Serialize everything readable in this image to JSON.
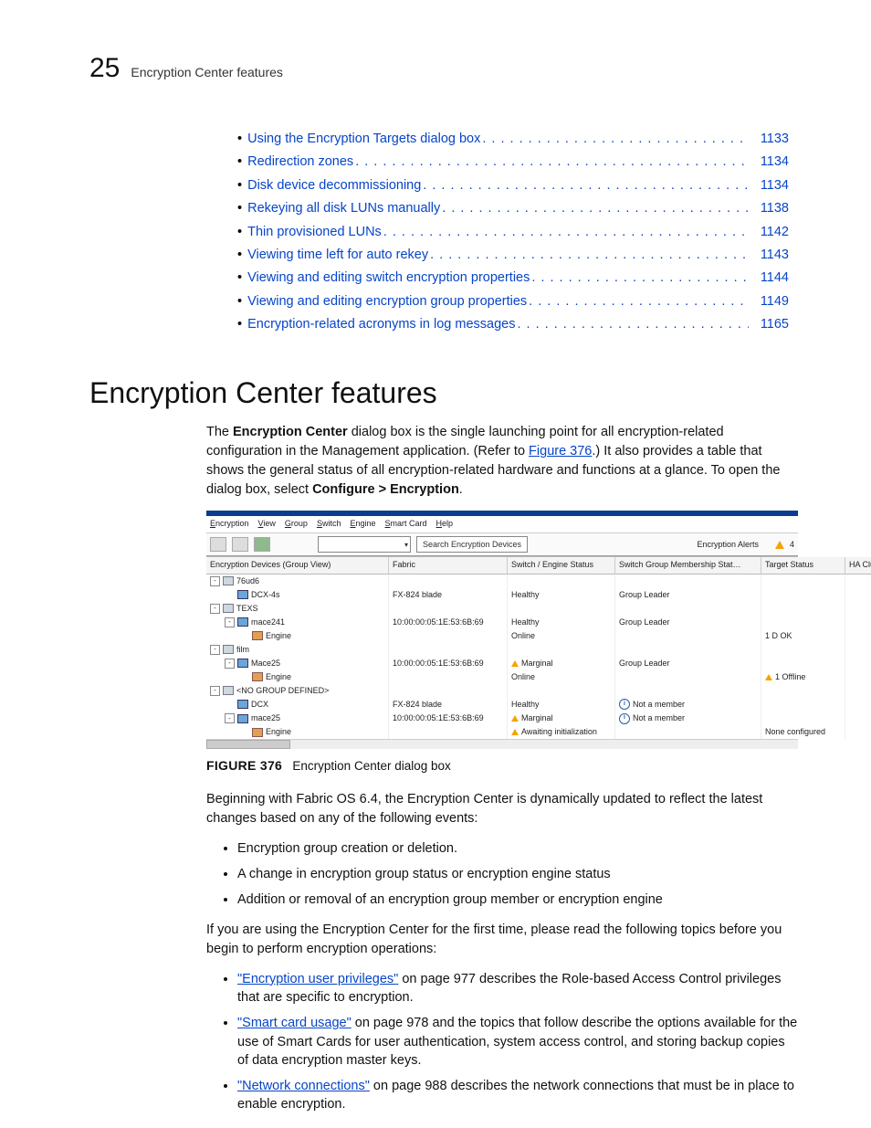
{
  "header": {
    "chapter_number": "25",
    "chapter_title": "Encryption Center features"
  },
  "toc": [
    {
      "label": "Using the Encryption Targets dialog box",
      "page": "1133"
    },
    {
      "label": "Redirection zones",
      "page": "1134"
    },
    {
      "label": "Disk device decommissioning",
      "page": "1134"
    },
    {
      "label": "Rekeying all disk LUNs manually",
      "page": "1138"
    },
    {
      "label": "Thin provisioned LUNs",
      "page": "1142"
    },
    {
      "label": "Viewing time left for auto rekey",
      "page": "1143"
    },
    {
      "label": "Viewing and editing switch encryption properties",
      "page": "1144"
    },
    {
      "label": "Viewing and editing encryption group properties",
      "page": "1149"
    },
    {
      "label": "Encryption-related acronyms in log messages",
      "page": "1165"
    }
  ],
  "section_heading": "Encryption Center features",
  "intro": {
    "p1a": "The ",
    "p1b": "Encryption Center",
    "p1c": " dialog box is the single launching point for all encryption-related configuration in the Management application. (Refer to ",
    "p1link": "Figure 376",
    "p1d": ".) It also provides a table that shows the general status of all encryption-related hardware and functions at a glance. To open the dialog box, select ",
    "p1e": "Configure > Encryption",
    "p1f": "."
  },
  "figure": {
    "menus": [
      "Encryption",
      "View",
      "Group",
      "Switch",
      "Engine",
      "Smart Card",
      "Help"
    ],
    "search_label": "Search Encryption Devices",
    "alerts_label": "Encryption Alerts",
    "alerts_count": "4",
    "columns": [
      "Encryption Devices (Group View)",
      "Fabric",
      "Switch / Engine Status",
      "Switch Group Membership Stat…",
      "Target Status",
      "HA Cluster"
    ],
    "rows": [
      {
        "indent": 0,
        "tree": "-",
        "ico": "grp",
        "c0": "76ud6",
        "c1": "",
        "c2": "",
        "c3": "",
        "c4": "",
        "c5": ""
      },
      {
        "indent": 1,
        "tree": "",
        "ico": "dev",
        "c0": "DCX-4s",
        "c1": "FX-824 blade",
        "c2": "Healthy",
        "c3": "Group Leader",
        "c4": "",
        "c5": ""
      },
      {
        "indent": 0,
        "tree": "-",
        "ico": "grp",
        "c0": "TEXS",
        "c1": "",
        "c2": "",
        "c3": "",
        "c4": "",
        "c5": ""
      },
      {
        "indent": 1,
        "tree": "-",
        "ico": "dev",
        "c0": "mace241",
        "c1": "10:00:00:05:1E:53:6B:69",
        "c2": "Healthy",
        "c3": "Group Leader",
        "c4": "",
        "c5": ""
      },
      {
        "indent": 2,
        "tree": "",
        "ico": "eng",
        "c0": "Engine",
        "c1": "",
        "c2": "Online",
        "c3": "",
        "c4": "1 D OK",
        "c5": ""
      },
      {
        "indent": 0,
        "tree": "-",
        "ico": "grp",
        "c0": "film",
        "c1": "",
        "c2": "",
        "c3": "",
        "c4": "",
        "c5": ""
      },
      {
        "indent": 1,
        "tree": "-",
        "ico": "dev",
        "c0": "Mace25",
        "c1": "10:00:00:05:1E:53:6B:69",
        "c2": "Marginal",
        "c2warn": true,
        "c3": "Group Leader",
        "c4": "",
        "c5": ""
      },
      {
        "indent": 2,
        "tree": "",
        "ico": "eng",
        "c0": "Engine",
        "c1": "",
        "c2": "Online",
        "c3": "",
        "c4": "1 Offline",
        "c4warn": true,
        "c5": ""
      },
      {
        "indent": 0,
        "tree": "-",
        "ico": "grp",
        "c0": "<NO GROUP DEFINED>",
        "c1": "",
        "c2": "",
        "c3": "",
        "c4": "",
        "c5": ""
      },
      {
        "indent": 1,
        "tree": "",
        "ico": "dev",
        "c0": "DCX",
        "c1": "FX-824 blade",
        "c2": "Healthy",
        "c3": "Not a member",
        "c3info": true,
        "c4": "",
        "c5": ""
      },
      {
        "indent": 1,
        "tree": "-",
        "ico": "dev",
        "c0": "mace25",
        "c1": "10:00:00:05:1E:53:6B:69",
        "c2": "Marginal",
        "c2warn": true,
        "c3": "Not a member",
        "c3info": true,
        "c4": "",
        "c5": ""
      },
      {
        "indent": 2,
        "tree": "",
        "ico": "eng",
        "c0": "Engine",
        "c1": "",
        "c2": "Awaiting initialization",
        "c2warn": true,
        "c3": "",
        "c4": "None configured",
        "c5": ""
      }
    ],
    "caption_no": "FIGURE 376",
    "caption_text": "Encryption Center dialog box"
  },
  "after_fig_p": "Beginning with Fabric OS 6.4, the Encryption Center is dynamically updated to reflect the latest changes based on any of the following events:",
  "events": [
    "Encryption group creation or deletion.",
    "A change in encryption group status or encryption engine status",
    "Addition or removal of an encryption group member or encryption engine"
  ],
  "firsttime_p": "If you are using the Encryption Center for the first time, please read the following topics before you begin to perform encryption operations:",
  "topics": [
    {
      "link": "\"Encryption user privileges\"",
      "rest": " on page 977 describes the Role-based Access Control privileges that are specific to encryption."
    },
    {
      "link": "\"Smart card usage\"",
      "rest": " on page 978 and the topics that follow describe the options available for the use of Smart Cards for user authentication, system access control, and storing backup copies of data encryption master keys."
    },
    {
      "link": "\"Network connections\"",
      "rest": " on page 988 describes the network connections that must be in place to enable encryption."
    }
  ]
}
